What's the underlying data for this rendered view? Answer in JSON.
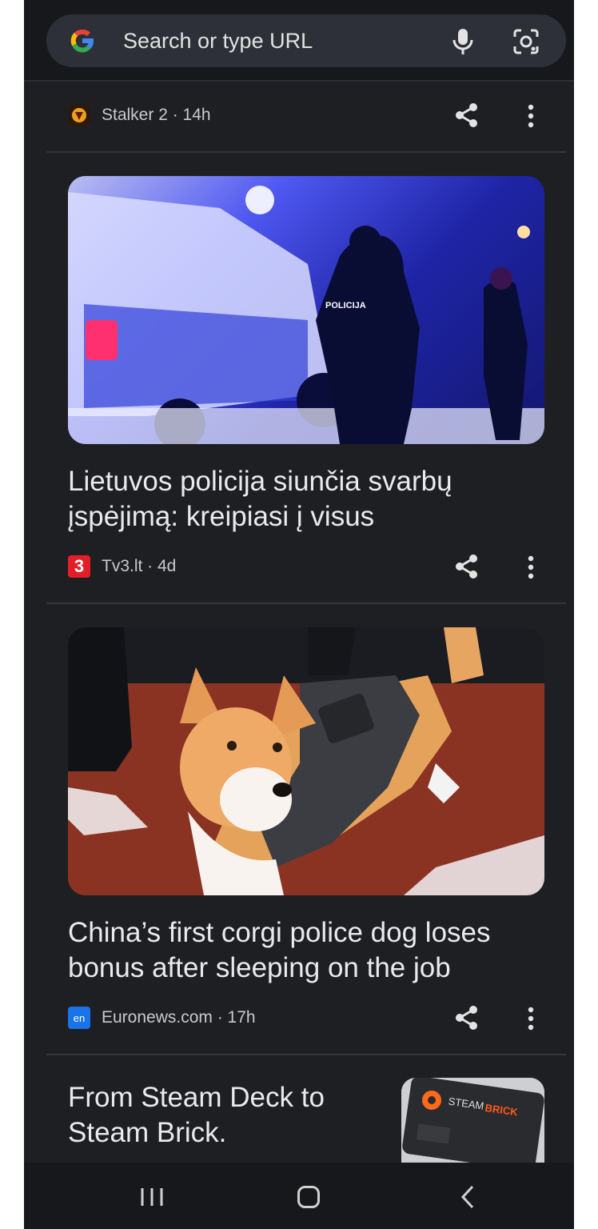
{
  "search": {
    "placeholder": "Search or type URL",
    "icons": [
      "google-g-icon",
      "microphone-icon",
      "camera-lens-icon"
    ]
  },
  "feed": [
    {
      "source": "Stalker 2",
      "age": "14h",
      "meta": "Stalker 2 · 14h"
    },
    {
      "headline_line1": "Lietuvos policija siunčia svarbų",
      "headline_line2": "įspėjimą: kreipiasi į visus",
      "source": "Tv3.lt",
      "source_badge": "3",
      "age": "4d",
      "meta": "Tv3.lt · 4d",
      "image": "police-at-night-image",
      "image_text": "POLICIJA"
    },
    {
      "headline_line1": "China’s first corgi police dog loses",
      "headline_line2": "bonus after sleeping on the job",
      "source": "Euronews.com",
      "source_badge": "en",
      "age": "17h",
      "meta": "Euronews.com · 17h",
      "image": "corgi-police-dog-image"
    },
    {
      "headline_line1": "From Steam Deck to",
      "headline_line2": "Steam Brick.",
      "image": "steam-brick-thumbnail",
      "image_text_1": "STEAM",
      "image_text_2": "BRICK"
    }
  ],
  "navbar": {
    "icons": [
      "recent-apps-icon",
      "home-icon",
      "back-icon"
    ]
  },
  "colors": {
    "background": "#1e1f23",
    "bar": "#17181b",
    "search_pill": "#2d3038",
    "tv3_red": "#e41e26",
    "euronews_blue": "#1a73e8"
  }
}
